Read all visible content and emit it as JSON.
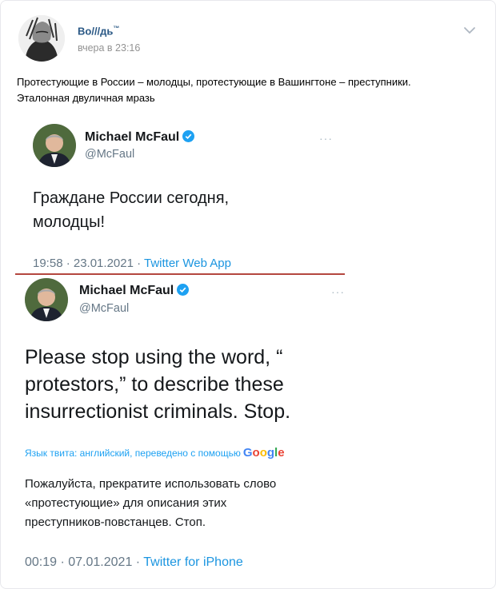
{
  "post": {
    "author": "Bo///дь",
    "author_mark": "™",
    "time": "вчера в 23:16",
    "text_line1": "Протестующие в России – молодцы, протестующие в Вашингтоне – преступники.",
    "text_line2": "Эталонная двуличная мразь"
  },
  "tweet1": {
    "name": "Michael McFaul",
    "handle": "@McFaul",
    "body_line1": "Граждане России сегодня,",
    "body_line2": "молодцы!",
    "meta_time": "19:58 · 23.01.2021 · ",
    "meta_app": "Twitter Web App"
  },
  "tweet2": {
    "name": "Michael McFaul",
    "handle": "@McFaul",
    "body_line1": "Please stop using the word, “",
    "body_line2": "protestors,” to describe these",
    "body_line3": "insurrectionist criminals. Stop.",
    "translate_note": "Язык твита: английский, переведено с помощью",
    "translate_brand": "Google",
    "translation_line1": "Пожалуйста, прекратите использовать слово",
    "translation_line2": "«протестующие» для описания этих",
    "translation_line3": "преступников-повстанцев. Стоп.",
    "meta_time": "00:19 · 07.01.2021 · ",
    "meta_app": "Twitter for iPhone"
  },
  "colors": {
    "link": "#2a5885",
    "twitter_blue": "#1da1f2",
    "divider": "#b4473f"
  },
  "icons": [
    "avatar-sketch",
    "chevron-down-icon",
    "verified-icon",
    "more-dots-icon"
  ]
}
